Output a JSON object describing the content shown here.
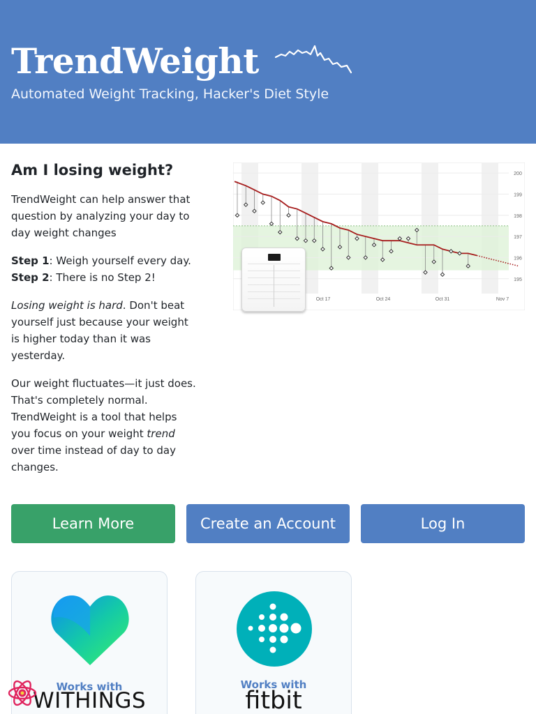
{
  "header": {
    "brand": "TrendWeight",
    "tagline": "Automated Weight Tracking, Hacker's Diet Style",
    "background": "#517fc3"
  },
  "intro": {
    "heading": "Am I losing weight?",
    "p1": "TrendWeight can help answer that question by analyzing your day to day weight changes",
    "step1_label": "Step 1",
    "step1_text": ": Weigh yourself every day.",
    "step2_label": "Step 2",
    "step2_text": ": There is no Step 2!",
    "p3_italic": "Losing weight is hard",
    "p3_rest": ". Don't beat yourself just because your weight is higher today than it was yesterday.",
    "p4_a": "Our weight fluctuates—it just does. That's completely normal. TrendWeight is a tool that helps you focus on your weight ",
    "p4_italic": "trend",
    "p4_b": " over time instead of day to day changes."
  },
  "chart_data": {
    "type": "line",
    "x_ticks": [
      "Oct 17",
      "Oct 24",
      "Oct 31",
      "Nov 7"
    ],
    "y_ticks": [
      200,
      199,
      198,
      197,
      196,
      195
    ],
    "ylim": [
      194.3,
      200.3
    ],
    "goal_band": [
      195.4,
      197.5
    ],
    "grid": true,
    "series": [
      {
        "values": [
          199.6,
          199.4,
          199.2,
          199.0,
          198.9,
          198.7,
          198.4,
          198.3,
          198.1,
          197.9,
          197.7,
          197.6,
          197.4,
          197.3,
          197.1,
          197.0,
          196.9,
          196.8,
          196.8,
          196.8,
          196.7,
          196.6,
          196.6,
          196.6,
          196.4,
          196.3,
          196.2,
          196.2,
          196.1
        ]
      },
      {
        "values": [
          198.0,
          198.5,
          198.2,
          198.6,
          197.6,
          197.2,
          198.0,
          196.9,
          196.8,
          196.8,
          196.4,
          195.5,
          196.5,
          196.0,
          196.9,
          196.0,
          196.6,
          195.9,
          196.3,
          196.9,
          196.9,
          197.3,
          195.3,
          195.8,
          195.2,
          196.3,
          196.2,
          195.6
        ]
      },
      {
        "values": [
          196.1,
          196.0,
          195.9,
          195.8,
          195.7,
          195.6
        ]
      }
    ]
  },
  "buttons": {
    "learn": "Learn More",
    "create": "Create an Account",
    "login": "Log In"
  },
  "cards": {
    "withings_works": "Works with",
    "withings_name": "WITHINGS",
    "fitbit_works": "Works with",
    "fitbit_name": "fitbit"
  },
  "colors": {
    "green": "#38a169",
    "blue": "#517fc3",
    "trend_line": "#a61c1c",
    "fitbit_teal": "#00b0b9"
  },
  "icons": [
    "trend-sparkline-icon",
    "withings-heart-logo",
    "fitbit-dots-logo",
    "react-devtools-icon"
  ]
}
